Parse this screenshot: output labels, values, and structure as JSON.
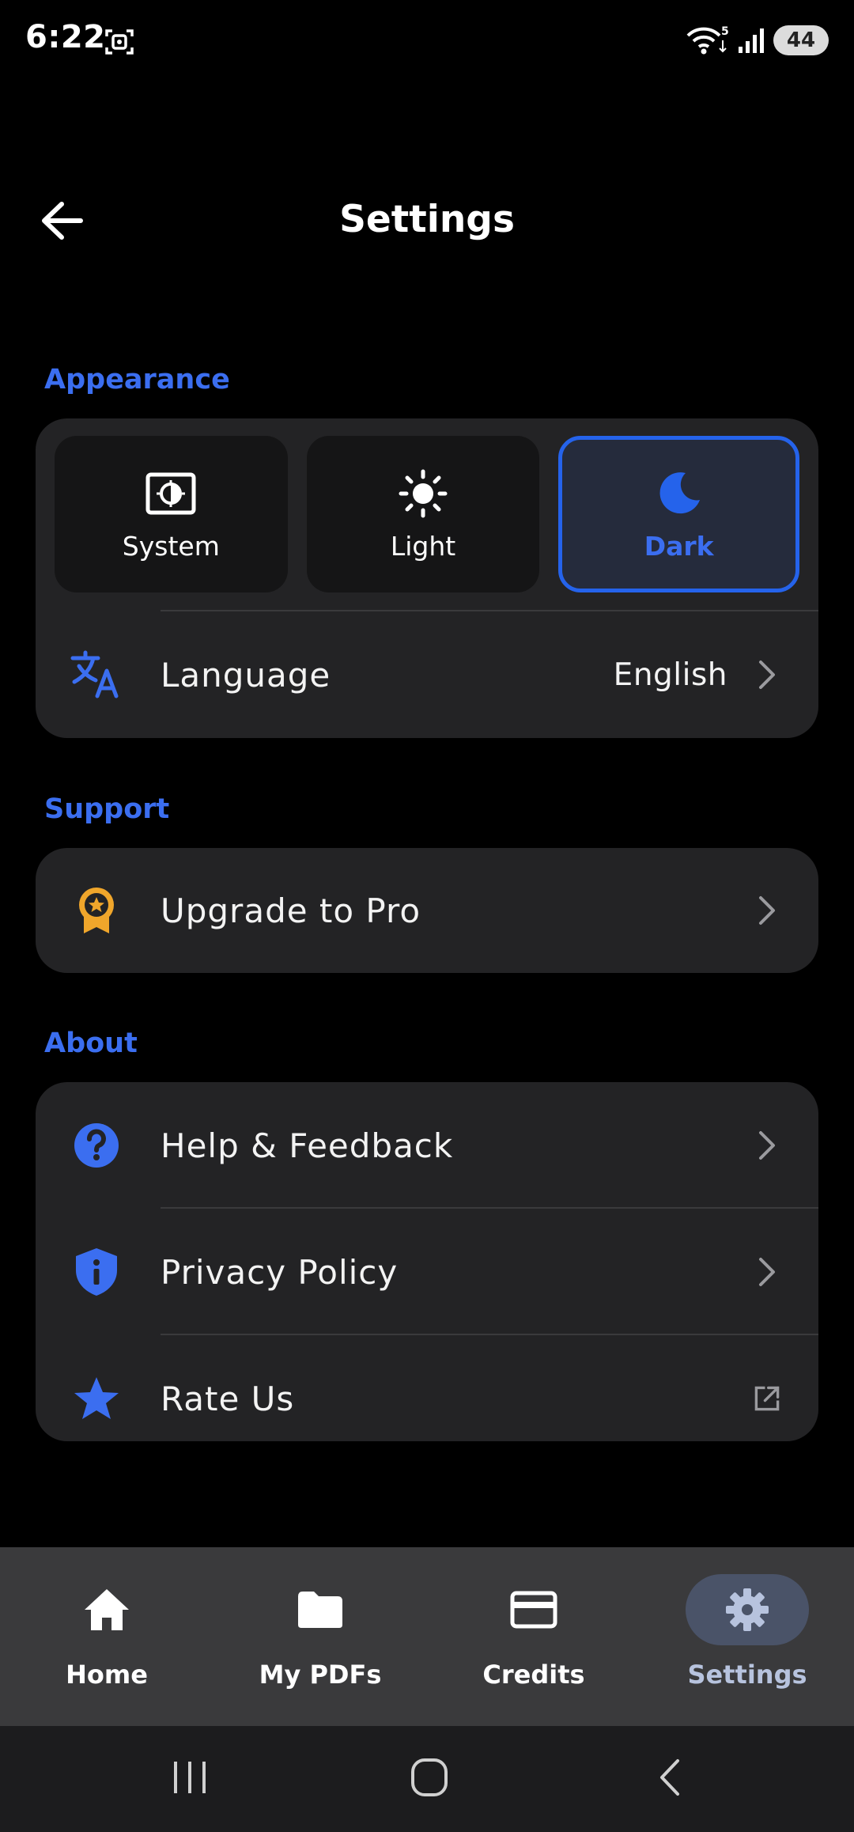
{
  "status_bar": {
    "time": "6:22",
    "wifi_badge": "5",
    "battery": "44"
  },
  "header": {
    "title": "Settings"
  },
  "appearance": {
    "section_label": "Appearance",
    "themes": [
      {
        "label": "System",
        "icon": "brightness-icon",
        "selected": false
      },
      {
        "label": "Light",
        "icon": "sun-icon",
        "selected": false
      },
      {
        "label": "Dark",
        "icon": "moon-icon",
        "selected": true
      }
    ],
    "language": {
      "label": "Language",
      "value": "English",
      "icon": "translate-icon"
    }
  },
  "support": {
    "section_label": "Support",
    "items": [
      {
        "label": "Upgrade to Pro",
        "icon": "award-badge-icon"
      }
    ]
  },
  "about": {
    "section_label": "About",
    "items": [
      {
        "label": "Help & Feedback",
        "icon": "help-circle-icon"
      },
      {
        "label": "Privacy Policy",
        "icon": "shield-info-icon"
      },
      {
        "label": "Rate Us",
        "icon": "star-icon"
      }
    ]
  },
  "bottom_nav": {
    "items": [
      {
        "label": "Home",
        "icon": "home-icon",
        "active": false
      },
      {
        "label": "My PDFs",
        "icon": "folder-icon",
        "active": false
      },
      {
        "label": "Credits",
        "icon": "credit-card-icon",
        "active": false
      },
      {
        "label": "Settings",
        "icon": "gear-icon",
        "active": true
      }
    ]
  },
  "colors": {
    "accent": "#2563eb",
    "section_label": "#3b6ef0",
    "card_bg": "#232325",
    "nav_bg": "#3a3a3c",
    "pro_icon": "#f0a62b"
  }
}
